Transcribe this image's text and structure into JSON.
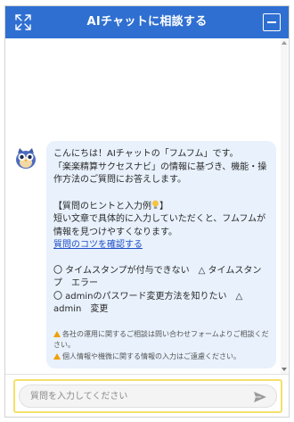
{
  "header": {
    "title": "AIチャットに相談する",
    "icons": {
      "expand": "expand-icon",
      "minimize": "minimize-icon"
    },
    "color": "#2f6fd1"
  },
  "message": {
    "avatar_icon": "owl-avatar-icon",
    "greeting": "こんにちは！AIチャットの「フムフム」です。\n「楽楽精算サクセスナビ」の情報に基づき、機能・操作方法のご質問にお答えします。",
    "hint_title": "【質問のヒントと入力例",
    "hint_body": "短い文章で具体的に入力していただくと、フムフムが情報を見つけやすくなります。",
    "hint_link": "質問のコツを確認する",
    "examples": "〇 タイムスタンプが付与できない　△ タイムスタンプ　エラー\n〇 adminのパスワード変更方法を知りたい　△ admin　変更",
    "notes": [
      "各社の運用に関するご相談は問い合わせフォームよりご相談ください。",
      "個人情報や機微に関する情報の入力はご遠慮ください。"
    ],
    "bubble_color": "#e8f1fc"
  },
  "input": {
    "placeholder": "質問を入力してください",
    "value": "",
    "send_icon": "send-icon"
  }
}
